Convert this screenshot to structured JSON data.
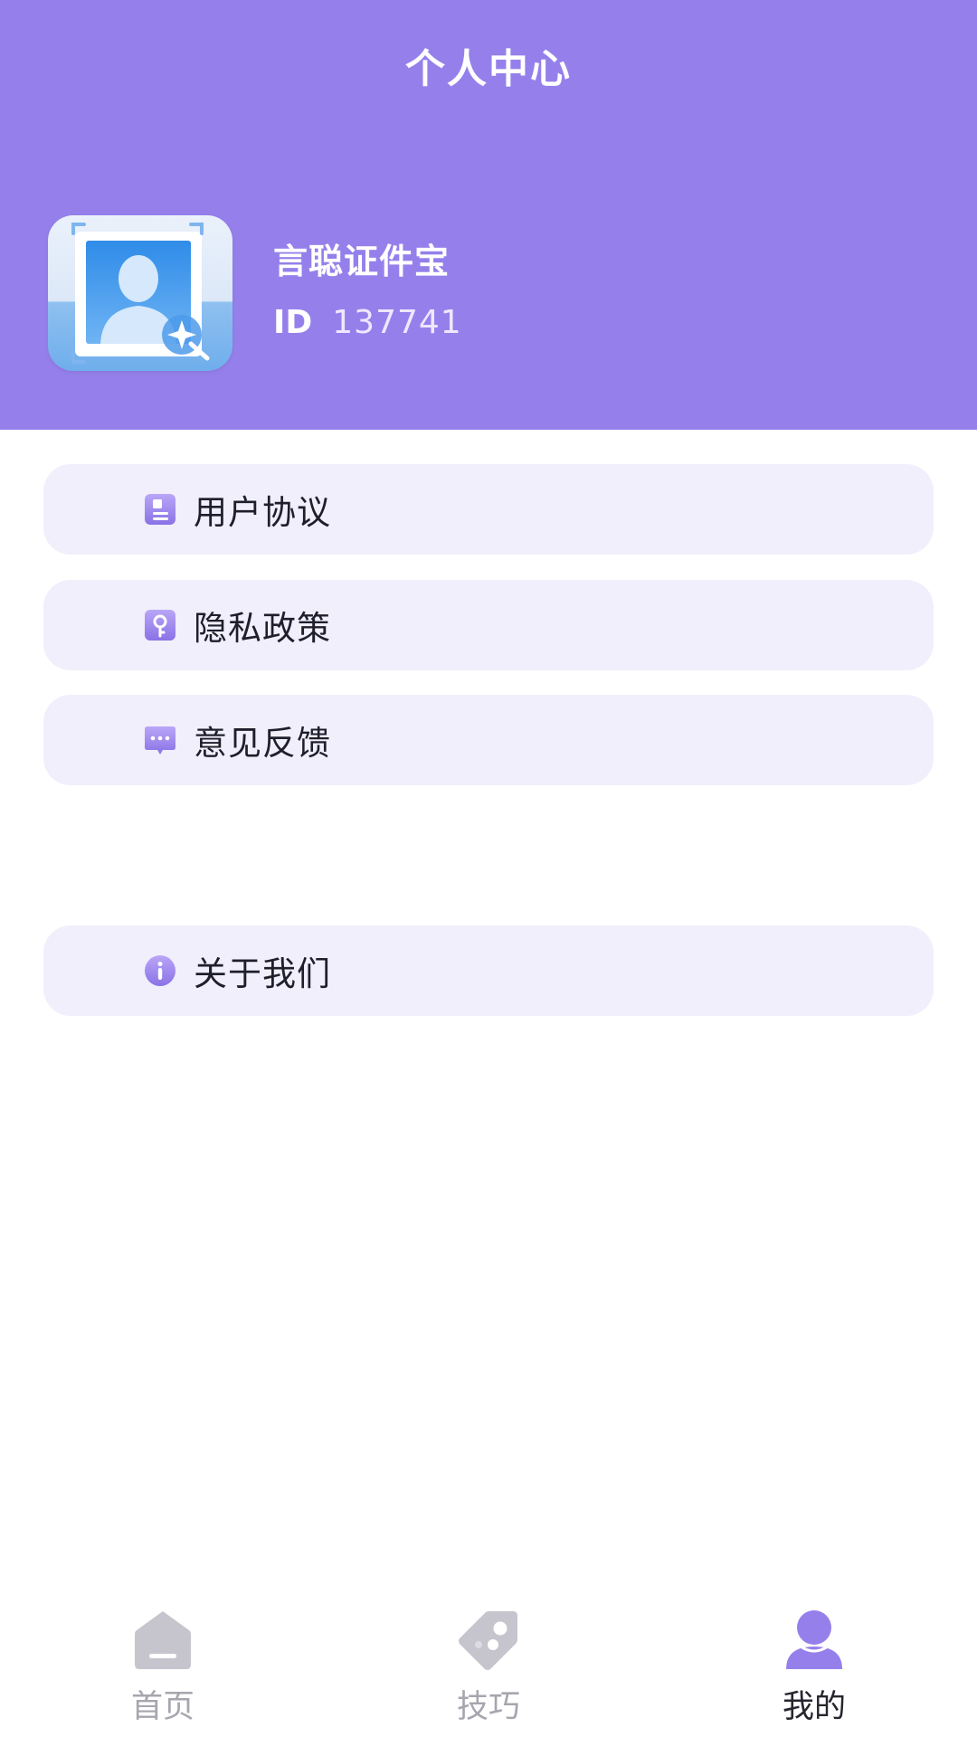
{
  "header": {
    "title": "个人中心",
    "bg_color": "#9580EB"
  },
  "profile": {
    "avatar_icon": "id-photo-icon",
    "app_name": "言聪证件宝",
    "id_label": "ID",
    "id_value": "137741"
  },
  "menu": {
    "items": [
      {
        "label": "用户协议",
        "icon": "document-icon"
      },
      {
        "label": "隐私政策",
        "icon": "key-icon"
      },
      {
        "label": "意见反馈",
        "icon": "message-icon"
      },
      {
        "label": "关于我们",
        "icon": "info-icon"
      }
    ]
  },
  "bottom_nav": {
    "items": [
      {
        "label": "首页",
        "icon": "home-icon",
        "active": false
      },
      {
        "label": "技巧",
        "icon": "tag-icon",
        "active": false
      },
      {
        "label": "我的",
        "icon": "user-icon",
        "active": true
      }
    ],
    "active_color": "#9580EB",
    "inactive_color": "#C6C5CD"
  }
}
